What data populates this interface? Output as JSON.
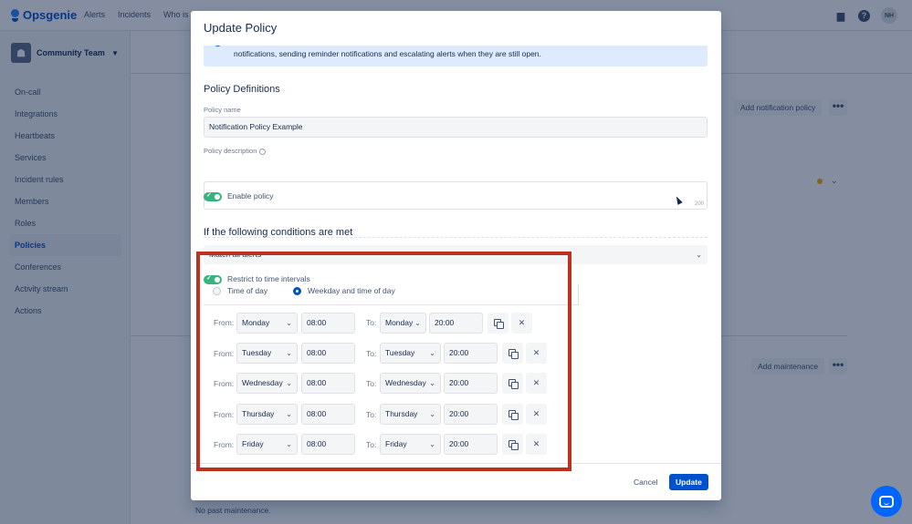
{
  "app": {
    "name": "Opsgenie"
  },
  "topnav": [
    "Alerts",
    "Incidents",
    "Who is"
  ],
  "user": {
    "initials": "NH"
  },
  "sidebar": {
    "team": "Community Team",
    "items": [
      {
        "label": "On-call"
      },
      {
        "label": "Integrations"
      },
      {
        "label": "Heartbeats"
      },
      {
        "label": "Services"
      },
      {
        "label": "Incident rules"
      },
      {
        "label": "Members"
      },
      {
        "label": "Roles"
      },
      {
        "label": "Policies",
        "active": true
      },
      {
        "label": "Conferences"
      },
      {
        "label": "Activity stream"
      },
      {
        "label": "Actions"
      }
    ]
  },
  "background": {
    "add_notification_policy": "Add notification policy",
    "add_maintenance": "Add maintenance",
    "no_past_maintenance": "No past maintenance."
  },
  "modal": {
    "title": "Update Policy",
    "info_text": "notifications, sending reminder notifications and escalating alerts when they are still open.",
    "policy_definitions": "Policy Definitions",
    "policy_name_label": "Policy name",
    "policy_name_value": "Notification Policy Example",
    "policy_description_label": "Policy description",
    "description_counter": "200",
    "enable_policy": "Enable policy",
    "conditions_title": "If the following conditions are met",
    "match_select": "Match all alerts",
    "restrict_label": "Restrict to time intervals",
    "radio_time_of_day": "Time of day",
    "radio_weekday": "Weekday and time of day",
    "from_label": "From:",
    "to_label": "To:",
    "intervals": [
      {
        "from_day": "Monday",
        "from_time": "08:00",
        "to_day": "Monday",
        "to_time": "20:00"
      },
      {
        "from_day": "Tuesday",
        "from_time": "08:00",
        "to_day": "Tuesday",
        "to_time": "20:00"
      },
      {
        "from_day": "Wednesday",
        "from_time": "08:00",
        "to_day": "Wednesday",
        "to_time": "20:00"
      },
      {
        "from_day": "Thursday",
        "from_time": "08:00",
        "to_day": "Thursday",
        "to_time": "20:00"
      },
      {
        "from_day": "Friday",
        "from_time": "08:00",
        "to_day": "Friday",
        "to_time": "20:00"
      }
    ],
    "cancel": "Cancel",
    "update": "Update"
  },
  "colors": {
    "accent": "#0052cc",
    "toggle_on": "#36b37e",
    "highlight_box": "#c0301f"
  }
}
